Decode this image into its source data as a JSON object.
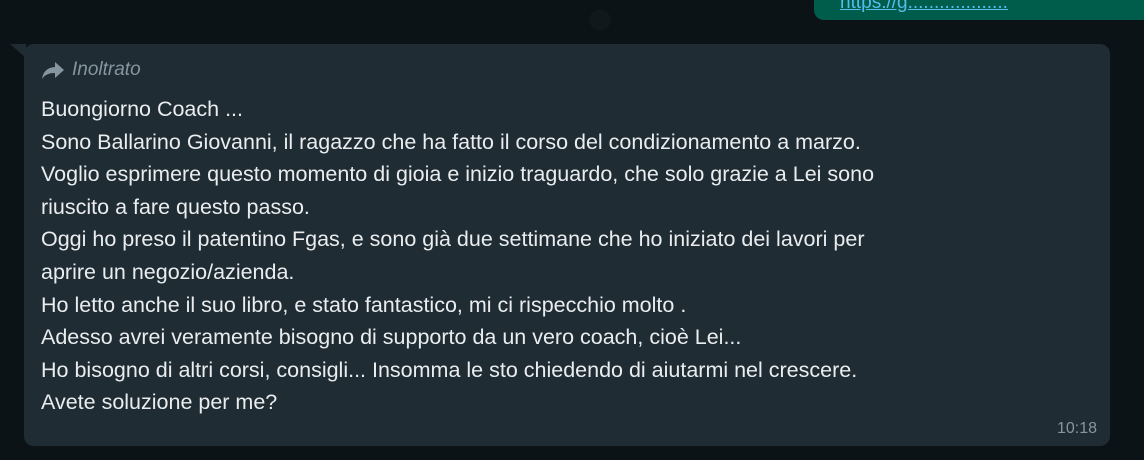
{
  "previous_message": {
    "link_text": "https://g..................."
  },
  "message": {
    "forwarded_label": "Inoltrato",
    "lines": [
      "Buongiorno Coach ...",
      "Sono Ballarino Giovanni, il ragazzo che ha fatto il corso del condizionamento a marzo.",
      "Voglio esprimere questo momento di gioia e inizio traguardo, che solo grazie a Lei sono",
      "riuscito a fare questo passo.",
      "Oggi ho preso il patentino Fgas, e sono già due settimane che ho iniziato dei lavori per",
      "aprire un negozio/azienda.",
      "Ho letto anche il suo libro, e stato fantastico, mi ci rispecchio molto .",
      "Adesso avrei veramente bisogno di supporto da un vero coach, cioè Lei...",
      "Ho bisogno di altri corsi, consigli... Insomma le sto chiedendo di aiutarmi nel crescere.",
      "Avete soluzione per me?"
    ],
    "time": "10:18"
  },
  "colors": {
    "bubble_background": "#202c33",
    "outgoing_bubble": "#005c4b",
    "text": "#e9edef",
    "meta_text": "#8696a0",
    "link": "#53bdeb",
    "chat_background": "#0c1317"
  },
  "icons": {
    "forwarded": "forward-arrow-icon"
  }
}
